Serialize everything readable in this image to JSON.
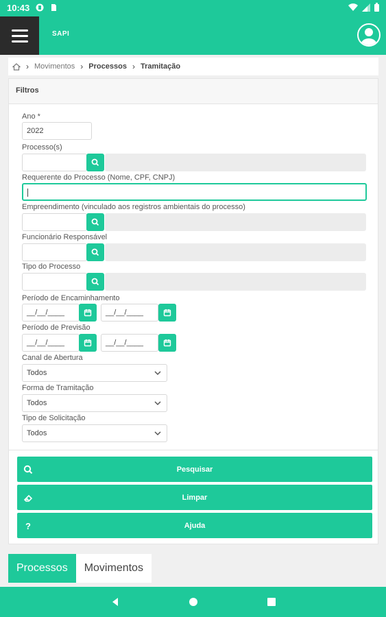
{
  "status_bar": {
    "time": "10:43"
  },
  "app_bar": {
    "logo": "SAPI"
  },
  "breadcrumb": {
    "items": [
      "Movimentos",
      "Processos",
      "Tramitação"
    ]
  },
  "filters": {
    "title": "Filtros",
    "ano": {
      "label": "Ano *",
      "value": "2022"
    },
    "processos": {
      "label": "Processo(s)"
    },
    "requerente": {
      "label": "Requerente do Processo (Nome, CPF, CNPJ)"
    },
    "empreendimento": {
      "label": "Empreendimento (vinculado aos registros ambientais do processo)"
    },
    "funcionario": {
      "label": "Funcionário Responsável"
    },
    "tipo_processo": {
      "label": "Tipo do Processo"
    },
    "periodo_encaminhamento": {
      "label": "Período de Encaminhamento",
      "start_placeholder": "__/__/____",
      "end_placeholder": "__/__/____"
    },
    "periodo_previsao": {
      "label": "Período de Previsão",
      "start_placeholder": "__/__/____",
      "end_placeholder": "__/__/____"
    },
    "canal_abertura": {
      "label": "Canal de Abertura",
      "value": "Todos"
    },
    "forma_tramitacao": {
      "label": "Forma de Tramitação",
      "value": "Todos"
    },
    "tipo_solicitacao": {
      "label": "Tipo de Solicitação",
      "value": "Todos"
    }
  },
  "actions": {
    "search": "Pesquisar",
    "clear": "Limpar",
    "help": "Ajuda"
  },
  "tabs": {
    "processos": "Processos",
    "movimentos": "Movimentos"
  },
  "colors": {
    "accent": "#1ec99a",
    "dark": "#2b2b2b"
  }
}
